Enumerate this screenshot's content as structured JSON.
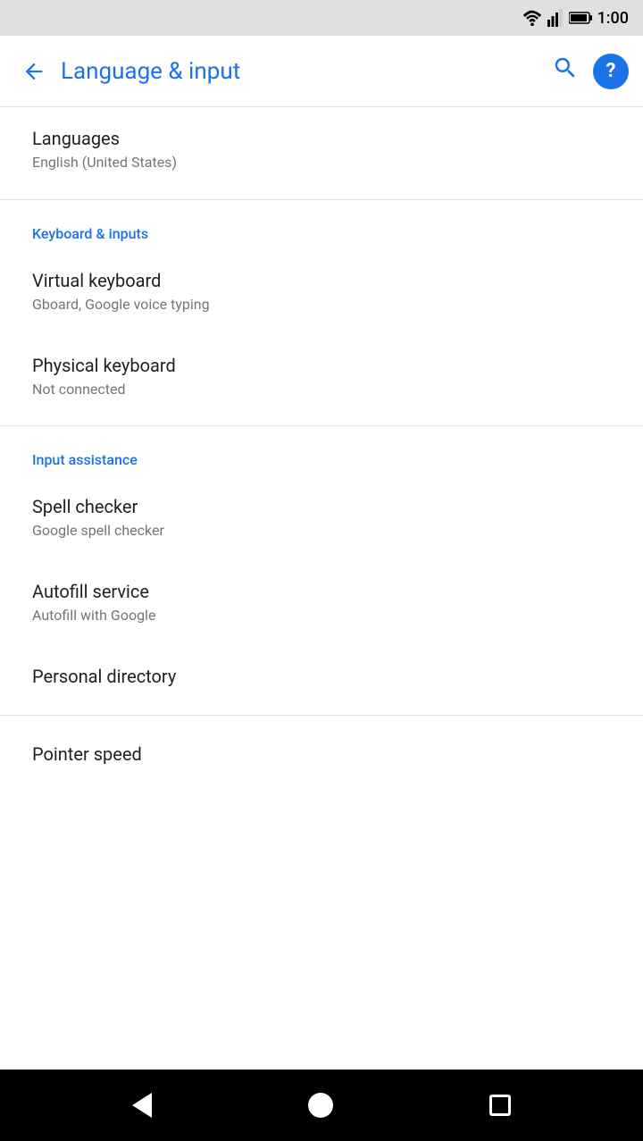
{
  "statusBar": {
    "time": "1:00"
  },
  "appBar": {
    "title": "Language & input",
    "backLabel": "←",
    "searchLabel": "🔍",
    "helpLabel": "?"
  },
  "sections": [
    {
      "id": "languages-section",
      "items": [
        {
          "id": "languages",
          "title": "Languages",
          "subtitle": "English (United States)"
        }
      ]
    },
    {
      "id": "keyboard-section",
      "header": "Keyboard & inputs",
      "items": [
        {
          "id": "virtual-keyboard",
          "title": "Virtual keyboard",
          "subtitle": "Gboard, Google voice typing"
        },
        {
          "id": "physical-keyboard",
          "title": "Physical keyboard",
          "subtitle": "Not connected"
        }
      ]
    },
    {
      "id": "input-assistance-section",
      "header": "Input assistance",
      "items": [
        {
          "id": "spell-checker",
          "title": "Spell checker",
          "subtitle": "Google spell checker"
        },
        {
          "id": "autofill-service",
          "title": "Autofill service",
          "subtitle": "Autofill with Google"
        },
        {
          "id": "personal-directory",
          "title": "Personal directory",
          "subtitle": ""
        }
      ]
    },
    {
      "id": "pointer-section",
      "items": [
        {
          "id": "pointer-speed",
          "title": "Pointer speed",
          "subtitle": ""
        }
      ]
    }
  ],
  "navBar": {
    "backLabel": "back",
    "homeLabel": "home",
    "recentsLabel": "recents"
  }
}
